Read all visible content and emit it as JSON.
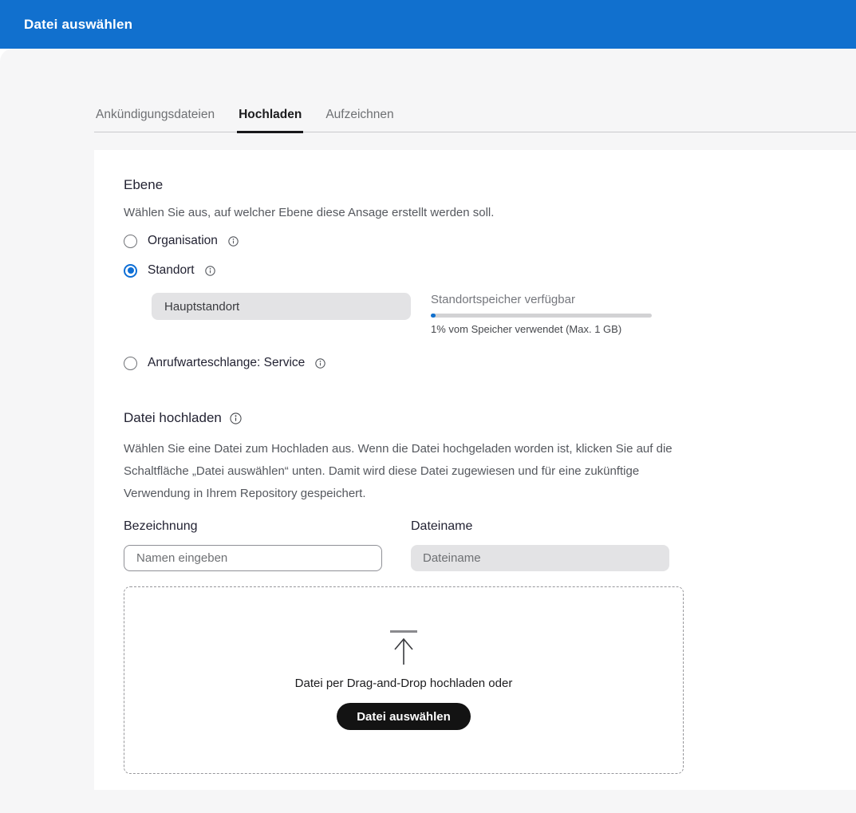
{
  "header": {
    "title": "Datei auswählen"
  },
  "tabs": [
    {
      "label": "Ankündigungsdateien",
      "active": false
    },
    {
      "label": "Hochladen",
      "active": true
    },
    {
      "label": "Aufzeichnen",
      "active": false
    }
  ],
  "level_section": {
    "title": "Ebene",
    "description": "Wählen Sie aus, auf welcher Ebene diese Ansage erstellt werden soll.",
    "options": [
      {
        "label": "Organisation",
        "selected": false,
        "icon": "info-icon"
      },
      {
        "label": "Standort",
        "selected": true,
        "icon": "info-icon"
      },
      {
        "label": "Anrufwarteschlange: Service",
        "selected": false,
        "icon": "info-icon"
      }
    ],
    "site_field_value": "Hauptstandort",
    "storage": {
      "title": "Standortspeicher verfügbar",
      "used_percent": 1,
      "caption": "1% vom Speicher verwendet (Max. 1 GB)"
    }
  },
  "upload_section": {
    "title": "Datei hochladen",
    "title_icon": "info-icon",
    "description": "Wählen Sie eine Datei zum Hochladen aus. Wenn die Datei hochgeladen worden ist, klicken Sie auf die Schaltfläche „Datei auswählen“ unten. Damit wird diese Datei zugewiesen und für eine zukünftige Verwendung in Ihrem Repository gespeichert.",
    "name_label": "Bezeichnung",
    "name_placeholder": "Namen eingeben",
    "filename_label": "Dateiname",
    "filename_placeholder": "Dateiname",
    "dropzone": {
      "icon": "upload-arrow-icon",
      "text": "Datei per Drag-and-Drop hochladen oder",
      "button_label": "Datei auswählen"
    }
  },
  "colors": {
    "header_blue": "#1170CE",
    "radio_blue": "#0E6FD6",
    "panel_gray": "#F6F6F7",
    "progress_fill": "#1170CE",
    "button_black": "#131313"
  }
}
